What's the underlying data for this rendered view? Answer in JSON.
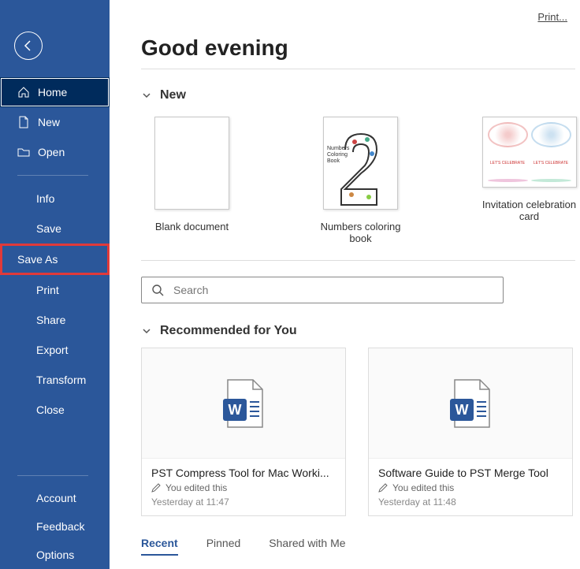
{
  "header": {
    "print_link": "Print...",
    "greeting": "Good evening"
  },
  "sidebar": {
    "home": "Home",
    "new": "New",
    "open": "Open",
    "info": "Info",
    "save": "Save",
    "save_as": "Save As",
    "print": "Print",
    "share": "Share",
    "export": "Export",
    "transform": "Transform",
    "close": "Close",
    "account": "Account",
    "feedback": "Feedback",
    "options": "Options"
  },
  "sections": {
    "new": "New",
    "recommended": "Recommended for You"
  },
  "search": {
    "placeholder": "Search"
  },
  "templates": [
    {
      "label": "Blank document"
    },
    {
      "label": "Numbers coloring book",
      "thumb_text": "Numbers\nColoring\nBook"
    },
    {
      "label": "Invitation celebration card",
      "cell_text": "LET'S CELEBRATE"
    }
  ],
  "recommended": [
    {
      "title": "PST Compress Tool for Mac Worki...",
      "meta": "You edited this",
      "time": "Yesterday at 11:47"
    },
    {
      "title": "Software Guide to PST Merge Tool",
      "meta": "You edited this",
      "time": "Yesterday at 11:48"
    }
  ],
  "tabs": {
    "recent": "Recent",
    "pinned": "Pinned",
    "shared": "Shared with Me"
  }
}
